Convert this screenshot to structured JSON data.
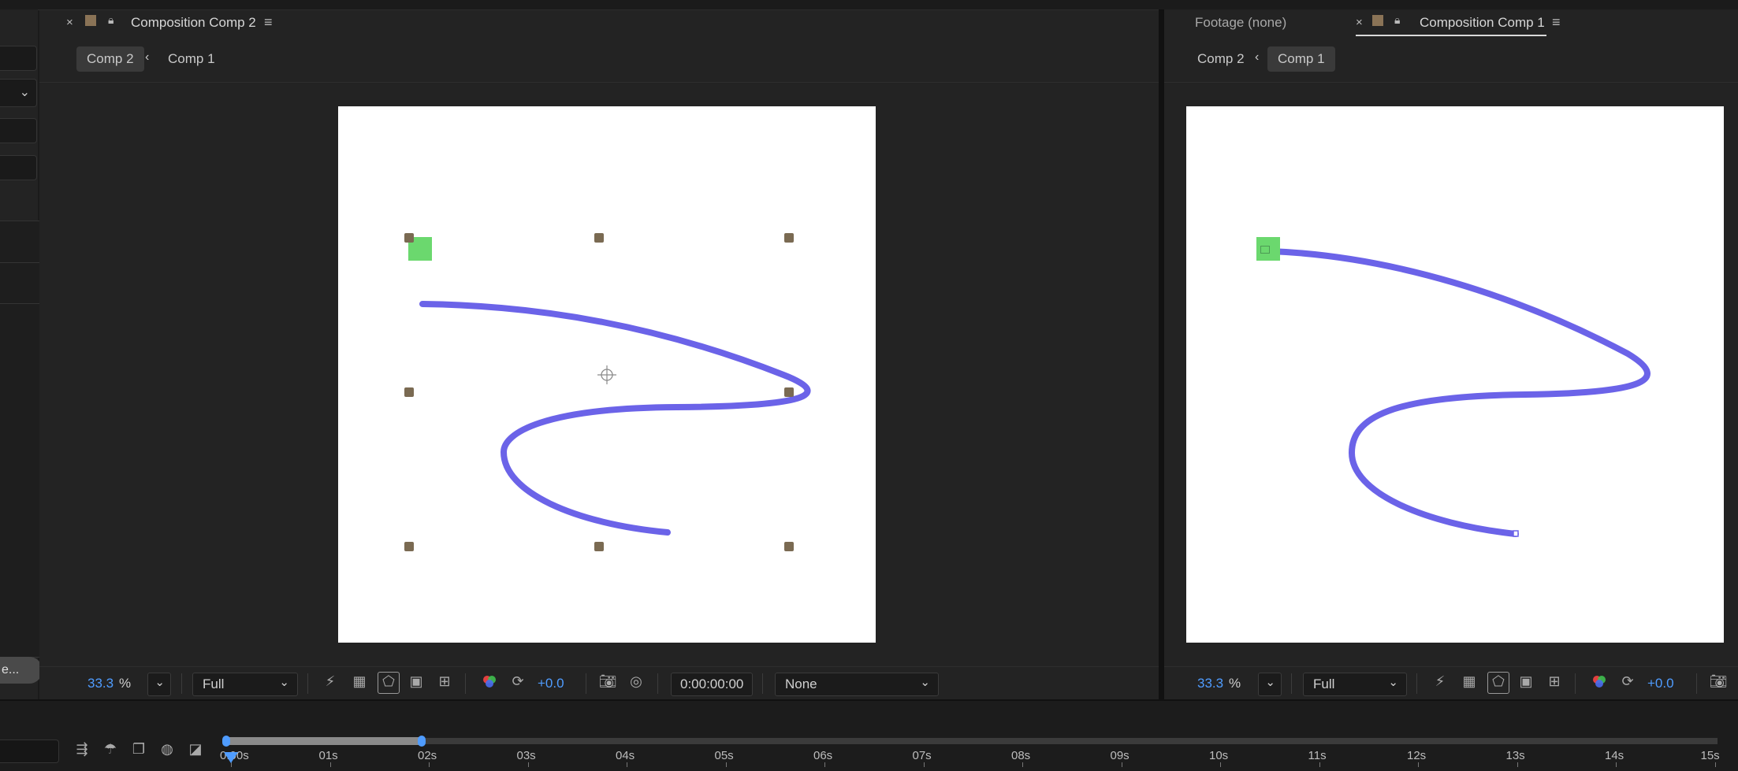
{
  "left_panel": {
    "truncated_button": "e..."
  },
  "comp2_panel": {
    "tab_title": "Composition Comp 2",
    "breadcrumbs": [
      "Comp 2",
      "Comp 1"
    ],
    "active_crumb": "Comp 2",
    "toolbar": {
      "zoom": "33.3",
      "zoom_unit": "%",
      "resolution": "Full",
      "exposure": "+0.0",
      "timecode": "0:00:00:00",
      "view_option": "None"
    }
  },
  "comp1_panel": {
    "footage_tab": "Footage (none)",
    "tab_title": "Composition Comp 1",
    "breadcrumbs": [
      "Comp 2",
      "Comp 1"
    ],
    "active_crumb": "Comp 1",
    "toolbar": {
      "zoom": "33.3",
      "zoom_unit": "%",
      "resolution": "Full",
      "exposure": "+0.0"
    }
  },
  "timeline": {
    "ticks": [
      "0:00s",
      "01s",
      "02s",
      "03s",
      "04s",
      "05s",
      "06s",
      "07s",
      "08s",
      "09s",
      "10s",
      "11s",
      "12s",
      "13s",
      "14s",
      "15s"
    ]
  },
  "colors": {
    "path_stroke": "#6b63e8",
    "accent_blue": "#4f9cff",
    "layer_green": "#6bd86e",
    "handle_brown": "#7a6a52"
  }
}
